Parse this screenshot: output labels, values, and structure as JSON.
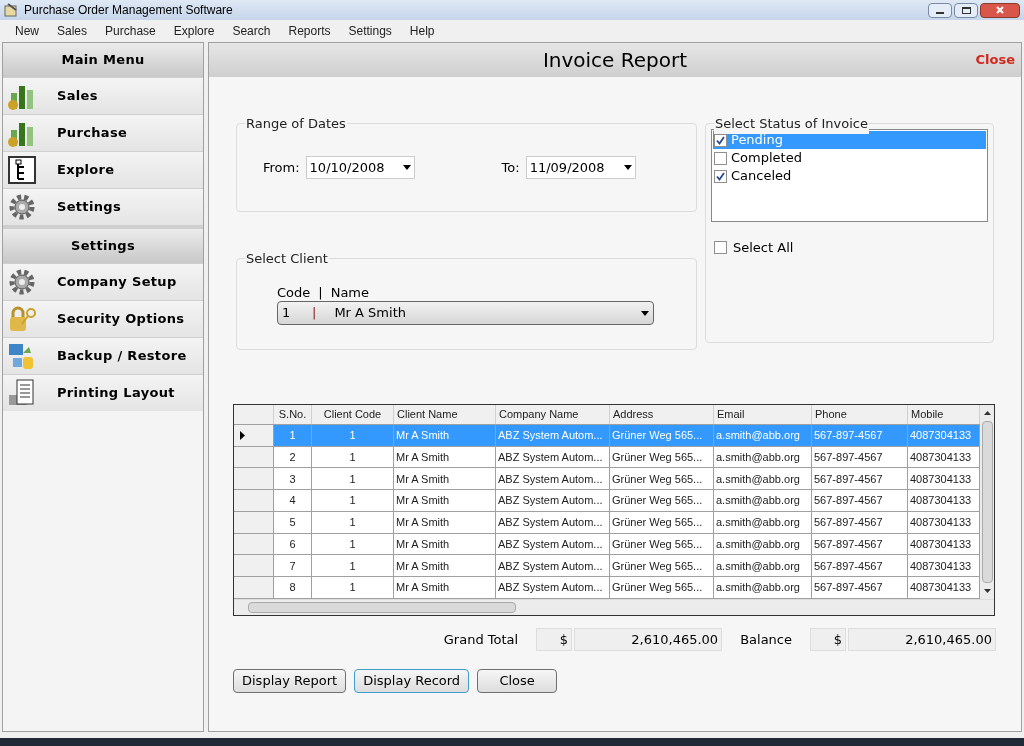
{
  "window": {
    "title": "Purchase Order Management Software"
  },
  "menu_bar": [
    "New",
    "Sales",
    "Purchase",
    "Explore",
    "Search",
    "Reports",
    "Settings",
    "Help"
  ],
  "sidebar": [
    {
      "title": "Main Menu",
      "items": [
        {
          "label": "Sales",
          "kind": "sales"
        },
        {
          "label": "Purchase",
          "kind": "purchase"
        },
        {
          "label": "Explore",
          "kind": "explore"
        },
        {
          "label": "Settings",
          "kind": "settings"
        }
      ]
    },
    {
      "title": "Settings",
      "items": [
        {
          "label": "Company Setup",
          "kind": "company"
        },
        {
          "label": "Security Options",
          "kind": "security"
        },
        {
          "label": "Backup / Restore",
          "kind": "backup"
        },
        {
          "label": "Printing Layout",
          "kind": "printing"
        }
      ]
    }
  ],
  "panel": {
    "title": "Invoice Report",
    "close": "Close"
  },
  "range_of_dates": {
    "legend": "Range of Dates",
    "from_label": "From:",
    "from": "10/10/2008",
    "to_label": "To:",
    "to": "11/09/2008"
  },
  "select_client": {
    "legend": "Select Client",
    "code_header": "Code",
    "separator": "|",
    "name_header": "Name",
    "code": "1",
    "name": "Mr A Smith"
  },
  "status": {
    "legend": "Select Status of Invoice",
    "items": [
      {
        "label": "Pending",
        "checked": true,
        "selected": true
      },
      {
        "label": "Completed",
        "checked": false,
        "selected": false
      },
      {
        "label": "Canceled",
        "checked": true,
        "selected": false
      }
    ],
    "select_all": {
      "label": "Select All",
      "checked": false
    }
  },
  "table": {
    "columns": [
      "S.No.",
      "Client Code",
      "Client Name",
      "Company Name",
      "Address",
      "Email",
      "Phone",
      "Mobile"
    ],
    "rows": [
      {
        "selected": true,
        "cells": [
          "1",
          "1",
          "Mr A Smith",
          "ABZ System Autom...",
          "Grüner Weg 565...",
          "a.smith@abb.org",
          "567-897-4567",
          "4087304133"
        ]
      },
      {
        "selected": false,
        "cells": [
          "2",
          "1",
          "Mr A Smith",
          "ABZ System Autom...",
          "Grüner Weg 565...",
          "a.smith@abb.org",
          "567-897-4567",
          "4087304133"
        ]
      },
      {
        "selected": false,
        "cells": [
          "3",
          "1",
          "Mr A Smith",
          "ABZ System Autom...",
          "Grüner Weg 565...",
          "a.smith@abb.org",
          "567-897-4567",
          "4087304133"
        ]
      },
      {
        "selected": false,
        "cells": [
          "4",
          "1",
          "Mr A Smith",
          "ABZ System Autom...",
          "Grüner Weg 565...",
          "a.smith@abb.org",
          "567-897-4567",
          "4087304133"
        ]
      },
      {
        "selected": false,
        "cells": [
          "5",
          "1",
          "Mr A Smith",
          "ABZ System Autom...",
          "Grüner Weg 565...",
          "a.smith@abb.org",
          "567-897-4567",
          "4087304133"
        ]
      },
      {
        "selected": false,
        "cells": [
          "6",
          "1",
          "Mr A Smith",
          "ABZ System Autom...",
          "Grüner Weg 565...",
          "a.smith@abb.org",
          "567-897-4567",
          "4087304133"
        ]
      },
      {
        "selected": false,
        "cells": [
          "7",
          "1",
          "Mr A Smith",
          "ABZ System Autom...",
          "Grüner Weg 565...",
          "a.smith@abb.org",
          "567-897-4567",
          "4087304133"
        ]
      },
      {
        "selected": false,
        "cells": [
          "8",
          "1",
          "Mr A Smith",
          "ABZ System Autom...",
          "Grüner Weg 565...",
          "a.smith@abb.org",
          "567-897-4567",
          "4087304133"
        ]
      }
    ]
  },
  "totals": [
    {
      "label": "Grand Total",
      "currency": "$",
      "value": "2,610,465.00"
    },
    {
      "label": "Balance",
      "currency": "$",
      "value": "2,610,465.00"
    }
  ],
  "buttons": [
    {
      "label": "Display Report",
      "focused": false
    },
    {
      "label": "Display Record",
      "focused": true
    },
    {
      "label": "Close",
      "focused": false
    }
  ]
}
